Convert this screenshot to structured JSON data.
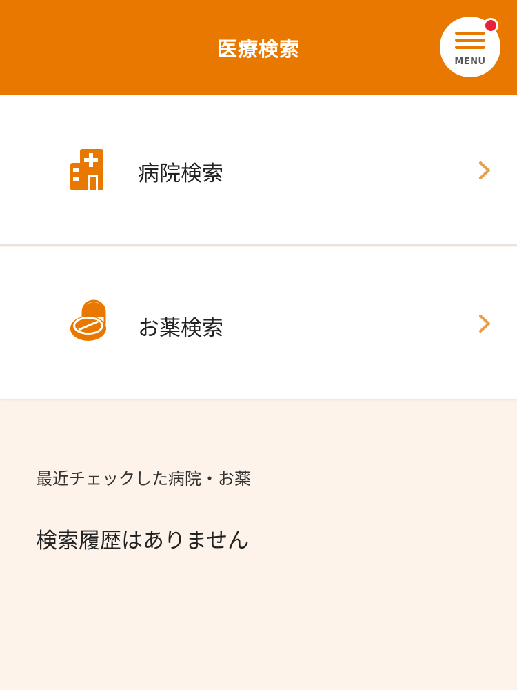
{
  "header": {
    "title": "医療検索",
    "menu_label": "MENU"
  },
  "nav": {
    "items": [
      {
        "label": "病院検索",
        "icon": "hospital-icon"
      },
      {
        "label": "お薬検索",
        "icon": "medicine-icon"
      }
    ]
  },
  "recent": {
    "heading": "最近チェックした病院・お薬",
    "empty_text": "検索履歴はありません"
  },
  "colors": {
    "accent": "#e87800",
    "notification": "#e8203a",
    "section_bg": "#fdf3ea"
  }
}
